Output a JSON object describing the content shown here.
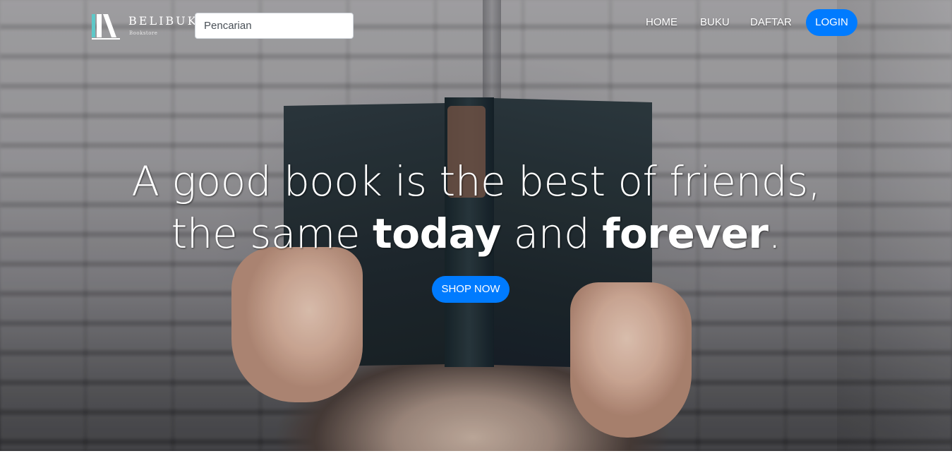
{
  "brand": {
    "name": "BELIBUK",
    "tagline": "Bookstore",
    "colors": {
      "teal": "#5ec8c8",
      "white": "#ffffff"
    }
  },
  "search": {
    "placeholder": "Pencarian"
  },
  "nav": {
    "links": [
      {
        "label": "HOME"
      },
      {
        "label": "BUKU"
      },
      {
        "label": "DAFTAR"
      }
    ],
    "login_label": "LOGIN"
  },
  "hero": {
    "line1": "A good book is the best of friends,",
    "line2_part1": "the same ",
    "line2_bold1": "today",
    "line2_part2": " and ",
    "line2_bold2": "forever",
    "line2_end": ".",
    "cta_label": "SHOP NOW"
  },
  "colors": {
    "primary": "#007bff"
  }
}
